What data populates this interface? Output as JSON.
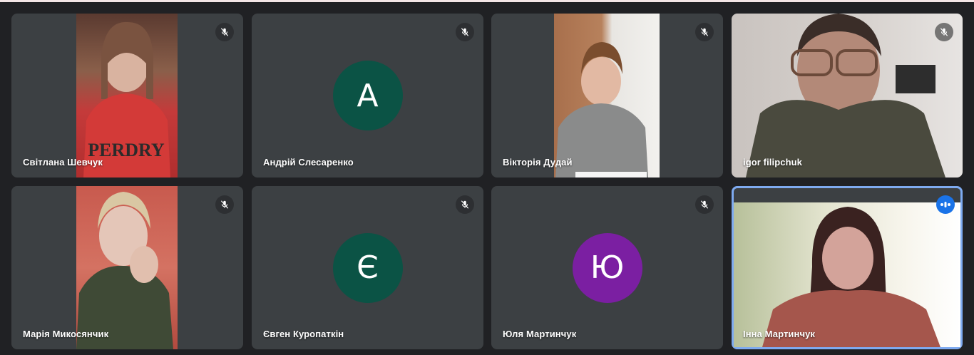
{
  "participants": [
    {
      "name": "Світлана Шевчук",
      "muted": true,
      "video": true
    },
    {
      "name": "Андрій Слесаренко",
      "muted": true,
      "video": false,
      "initial": "А",
      "avatar_color": "#0b5345"
    },
    {
      "name": "Вікторія Дудай",
      "muted": true,
      "video": true
    },
    {
      "name": "igor filipchuk",
      "muted": true,
      "video": true
    },
    {
      "name": "Марія Микосянчик",
      "muted": true,
      "video": true
    },
    {
      "name": "Євген Куропаткін",
      "muted": true,
      "video": false,
      "initial": "Є",
      "avatar_color": "#0b5345"
    },
    {
      "name": "Юля Мартинчук",
      "muted": true,
      "video": false,
      "initial": "Ю",
      "avatar_color": "#7b1fa2"
    },
    {
      "name": "Інна Мартинчук",
      "muted": false,
      "video": true,
      "speaking": true
    }
  ],
  "colors": {
    "background": "#202124",
    "tile": "#3c4043",
    "active_speaker_border": "#7eaaf0",
    "speaking_indicator": "#1a73e8"
  },
  "icons": {
    "mute": "mic-off-icon",
    "speaking": "audio-level-icon"
  }
}
